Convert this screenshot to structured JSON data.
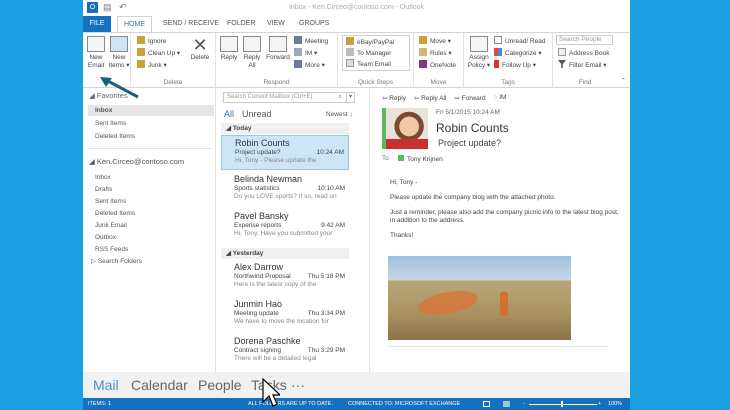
{
  "window": {
    "title": "Inbox - Ken.Circeo@contoso.com - Outlook"
  },
  "tabs": [
    "FILE",
    "HOME",
    "SEND / RECEIVE",
    "FOLDER",
    "VIEW",
    "GROUPS"
  ],
  "ribbon": {
    "new_email": "New Email",
    "new_items": "New Items ▾",
    "ignore": "Ignore",
    "clean_up": "Clean Up ▾",
    "junk": "Junk ▾",
    "delete": "Delete",
    "delete_group": "Delete",
    "reply": "Reply",
    "reply_all": "Reply All",
    "forward": "Forward",
    "meeting": "Meeting",
    "im": "IM ▾",
    "more": "More ▾",
    "respond_group": "Respond",
    "quick_steps": [
      "eBay/PayPal",
      "To Manager",
      "Team Email"
    ],
    "quick_steps_group": "Quick Steps",
    "move": "Move ▾",
    "rules": "Rules ▾",
    "onenote": "OneNote",
    "move_group": "Move",
    "assign_policy": "Assign Policy ▾",
    "unread_read": "Unread/ Read",
    "categorize": "Categorize ▾",
    "follow_up": "Follow Up ▾",
    "tags_group": "Tags",
    "search_people": "Search People",
    "address_book": "Address Book",
    "filter_email": "Filter Email ▾",
    "find_group": "Find"
  },
  "folders": {
    "favorites_label": "Favorites",
    "favorites": [
      "Inbox",
      "Sent Items",
      "Deleted Items"
    ],
    "account": "Ken.Circeo@contoso.com",
    "account_folders": [
      "Inbox",
      "Drafts",
      "Sent Items",
      "Deleted Items",
      "Junk Email",
      "Outbox",
      "RSS Feeds",
      "Search Folders"
    ]
  },
  "list": {
    "search_placeholder": "Search Current Mailbox (Ctrl+E)",
    "filter_all": "All",
    "filter_unread": "Unread",
    "sort": "Newest ↓",
    "groups": [
      {
        "label": "Today",
        "messages": [
          {
            "from": "Robin Counts",
            "subject": "Project update?",
            "time": "10:24 AM",
            "preview": "Hi, Tony - Please update the"
          },
          {
            "from": "Belinda Newman",
            "subject": "Sports statistics",
            "time": "10:10 AM",
            "preview": "Do you LOVE sports? If so, read on"
          },
          {
            "from": "Pavel Bansky",
            "subject": "Expense reports",
            "time": "9:42 AM",
            "preview": "Hi, Tony, Have you submitted your"
          }
        ]
      },
      {
        "label": "Yesterday",
        "messages": [
          {
            "from": "Alex Darrow",
            "subject": "Northwind Proposal",
            "time": "Thu 5:18 PM",
            "preview": "Here is the latest copy of the"
          },
          {
            "from": "Junmin Hao",
            "subject": "Meeting update",
            "time": "Thu 3:34 PM",
            "preview": "We have to move the location for"
          },
          {
            "from": "Dorena Paschke",
            "subject": "Contract signing",
            "time": "Thu 3:29 PM",
            "preview": "There will be a detailed legal"
          }
        ]
      }
    ]
  },
  "reading": {
    "actions": [
      "Reply",
      "Reply All",
      "Forward",
      "IM"
    ],
    "date": "Fri 5/1/2015 10:24 AM",
    "from": "Robin Counts",
    "subject": "Project update?",
    "to_label": "To",
    "to": "Tony Krijnen",
    "body": [
      "Hi, Tony -",
      "Please update the company blog with the attached photo.",
      "Just a reminder, please also add the company picnic info to the latest blog post, in addition to the address.",
      "Thanks!"
    ]
  },
  "nav": [
    "Mail",
    "Calendar",
    "People",
    "Tasks",
    "···"
  ],
  "status": {
    "items": "ITEMS: 1",
    "sync": "ALL FOLDERS ARE UP TO DATE.",
    "connection": "CONNECTED TO: MICROSOFT EXCHANGE",
    "zoom": "100%"
  },
  "colors": {
    "background": "#1ba1e2",
    "accent": "#1570c0",
    "selected": "#cde6f7"
  }
}
